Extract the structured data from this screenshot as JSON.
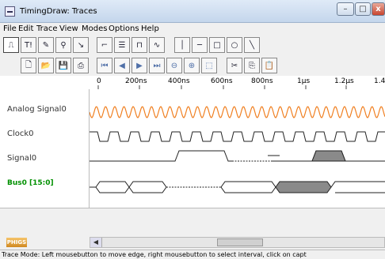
{
  "window": {
    "title": "TimingDraw: Traces",
    "minimize": "–",
    "maximize": "□",
    "close": "x"
  },
  "menu": [
    "File",
    "Edit",
    "Trace",
    "View",
    "Modes",
    "Options",
    "Help"
  ],
  "toolbar1": [
    {
      "icon": "rising-edge-icon",
      "glyph": "⎍"
    },
    {
      "icon": "text-tool-icon",
      "glyph": "T!"
    },
    {
      "icon": "edit-pencil-icon",
      "glyph": "✎"
    },
    {
      "icon": "zoom-tool-icon",
      "glyph": "⚲"
    },
    {
      "icon": "probe-icon",
      "glyph": "↘"
    },
    {
      "icon": "step-icon",
      "glyph": "⌐"
    },
    {
      "icon": "bus-icon",
      "glyph": "☰"
    },
    {
      "icon": "clock-icon",
      "glyph": "⊓"
    },
    {
      "icon": "sine-icon",
      "glyph": "∿"
    },
    {
      "icon": "vertical-line-icon",
      "glyph": "│"
    },
    {
      "icon": "horizontal-line-icon",
      "glyph": "─"
    },
    {
      "icon": "rectangle-icon",
      "glyph": "□"
    },
    {
      "icon": "ellipse-icon",
      "glyph": "○"
    },
    {
      "icon": "diagonal-line-icon",
      "glyph": "╲"
    }
  ],
  "toolbar2": [
    {
      "icon": "new-file-icon",
      "glyph": "🗋"
    },
    {
      "icon": "open-folder-icon",
      "glyph": "📂"
    },
    {
      "icon": "save-icon",
      "glyph": "💾"
    },
    {
      "icon": "print-icon",
      "glyph": "⎙"
    },
    {
      "icon": "skip-start-icon",
      "glyph": "⏮"
    },
    {
      "icon": "step-back-icon",
      "glyph": "◀"
    },
    {
      "icon": "step-forward-icon",
      "glyph": "▶"
    },
    {
      "icon": "skip-end-icon",
      "glyph": "⏭"
    },
    {
      "icon": "zoom-out-icon",
      "glyph": "⊖"
    },
    {
      "icon": "zoom-in-icon",
      "glyph": "⊕"
    },
    {
      "icon": "zoom-fit-icon",
      "glyph": "⬚"
    },
    {
      "icon": "cut-icon",
      "glyph": "✂"
    },
    {
      "icon": "copy-icon",
      "glyph": "⎘"
    },
    {
      "icon": "paste-icon",
      "glyph": "📋"
    }
  ],
  "ruler": [
    "0",
    "200ns",
    "400ns",
    "600ns",
    "800ns",
    "1µs",
    "1.2µs",
    "1.4"
  ],
  "signals": [
    {
      "name": "Analog Signal0",
      "type": "analog"
    },
    {
      "name": "Clock0",
      "type": "clock"
    },
    {
      "name": "Signal0",
      "type": "digital"
    },
    {
      "name": "Bus0 [15:0]",
      "type": "bus"
    }
  ],
  "colors": {
    "analog": "#f07f20",
    "bus_name": "#009000",
    "shaded": "#8a8a8a"
  },
  "logo": "PHIGS",
  "status": "Trace Mode: Left mousebutton to move edge, right mousebutton to select interval, click on capt"
}
